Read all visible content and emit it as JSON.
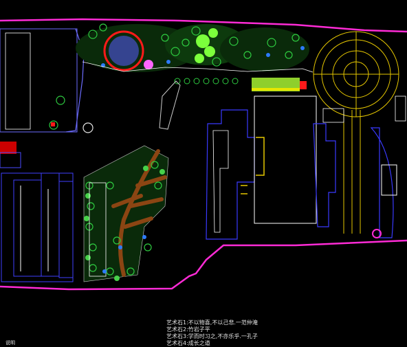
{
  "window": {
    "title": ""
  },
  "drawing": {
    "background": "#000000",
    "colors": {
      "boundary": "#ff2bd6",
      "building": "#3a3aff",
      "structure": "#ffffff",
      "trees": "#2ecc40",
      "plaza": "#e6c700",
      "path": "#8b4513",
      "water": "#2d7bff"
    },
    "icons": [
      "tree-symbol-icon",
      "circle-plaza-icon",
      "water-pool-icon"
    ]
  },
  "legend": {
    "lines": [
      "艺术石1:不以物喜,不以己悲.一范仲淹",
      "艺术石2:竹岩子平",
      "艺术石3:学而时习之,不亦乐乎.一孔子",
      "艺术石4:成长之道"
    ]
  },
  "bottom_note": "说明"
}
